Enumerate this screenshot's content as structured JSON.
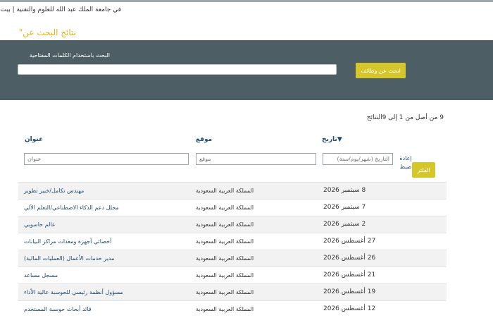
{
  "breadcrumb": {
    "text": "في جامعة الملك عبد الله للعلوم والتقنية | بيت"
  },
  "results_title": "نتائج البحث عن\"",
  "search": {
    "label": "البحث باستخدام الكلمات المفتاحية",
    "value": "",
    "button_label": "ابحث عن وظائف"
  },
  "summary": "9 من أصل من 1 إلى 9النتائج",
  "table": {
    "headers": {
      "title": "عنوان",
      "location": "موقع",
      "date": "تاريخ▼"
    },
    "filters": {
      "title_placeholder": "عنوان",
      "location_placeholder": "موقع",
      "date_placeholder": "التاريخ (شهر/يوم/سنة)"
    },
    "reset_label": "إعادة ضبط",
    "apply_label": "الفلتر",
    "rows": [
      {
        "title": "مهندس تكامل/خبير تطوير",
        "location": "المملكة العربية السعودية",
        "date": "8 سبتمبر 2026"
      },
      {
        "title": "محلل دعم الذكاء الاصطناعي/التعلم الآلي",
        "location": "المملكة العربية السعودية",
        "date": "7 سبتمبر 2026"
      },
      {
        "title": "عالم حاسوبي",
        "location": "المملكة العربية السعودية",
        "date": "2 سبتمبر 2026"
      },
      {
        "title": "أخصائي أجهزة ومعدات مراكز البيانات",
        "location": "المملكة العربية السعودية",
        "date": "27 أغسطس 2026"
      },
      {
        "title": "مدير خدمات الأعمال (العمليات المالية)",
        "location": "المملكة العربية السعودية",
        "date": "26 أغسطس 2026"
      },
      {
        "title": "مسجل مساعد",
        "location": "المملكة العربية السعودية",
        "date": "21 أغسطس 2026"
      },
      {
        "title": "مسؤول أنظمة رئيسي للحوسبة عالية الأداء",
        "location": "المملكة العربية السعودية",
        "date": "19 أغسطس 2026"
      },
      {
        "title": "قائد أبحاث حوسبة المستخدم",
        "location": "المملكة العربية السعودية",
        "date": "12 أغسطس 2026"
      }
    ]
  },
  "colors": {
    "accent": "#d5c62b",
    "panel": "#4d5e64",
    "link": "#1e4b6e",
    "title": "#e3b31b"
  }
}
